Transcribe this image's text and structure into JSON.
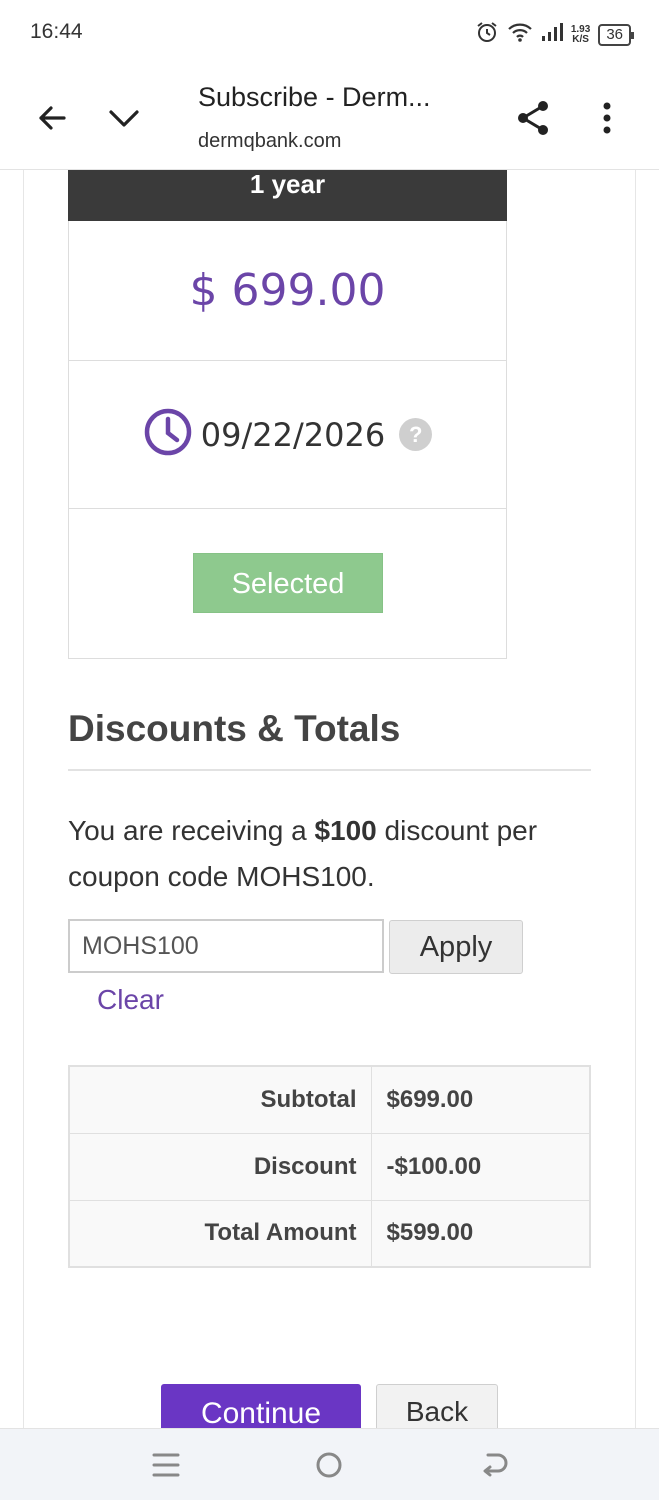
{
  "status_bar": {
    "time": "16:44",
    "speed_value": "1.93",
    "speed_unit": "K/S",
    "battery": "36",
    "icons": [
      "alarm-icon",
      "wifi-icon",
      "signal-icon",
      "battery-icon"
    ]
  },
  "browser": {
    "page_title": "Subscribe - Derm...",
    "url": "dermqbank.com",
    "icons": [
      "back-arrow-icon",
      "chevron-down-icon",
      "share-icon",
      "more-vert-icon"
    ]
  },
  "plan": {
    "header": "1 year",
    "price": "$ 699.00",
    "expiry_date": "09/22/2026",
    "help_glyph": "?",
    "selected_label": "Selected"
  },
  "discounts": {
    "title": "Discounts & Totals",
    "message_prefix": "You are receiving a ",
    "message_amount": "$100",
    "message_suffix": " discount per coupon code MOHS100.",
    "coupon_value": "MOHS100",
    "apply_label": "Apply",
    "clear_label": "Clear"
  },
  "totals": [
    {
      "label": "Subtotal",
      "value": "$699.00"
    },
    {
      "label": "Discount",
      "value": "-$100.00"
    },
    {
      "label": "Total Amount",
      "value": "$599.00"
    }
  ],
  "actions": {
    "continue_label": "Continue",
    "back_label": "Back"
  },
  "colors": {
    "accent_purple": "#6b45a8",
    "continue_purple": "#6a36c4",
    "selected_green": "#8ec98e",
    "header_dark": "#3a3a3a"
  }
}
